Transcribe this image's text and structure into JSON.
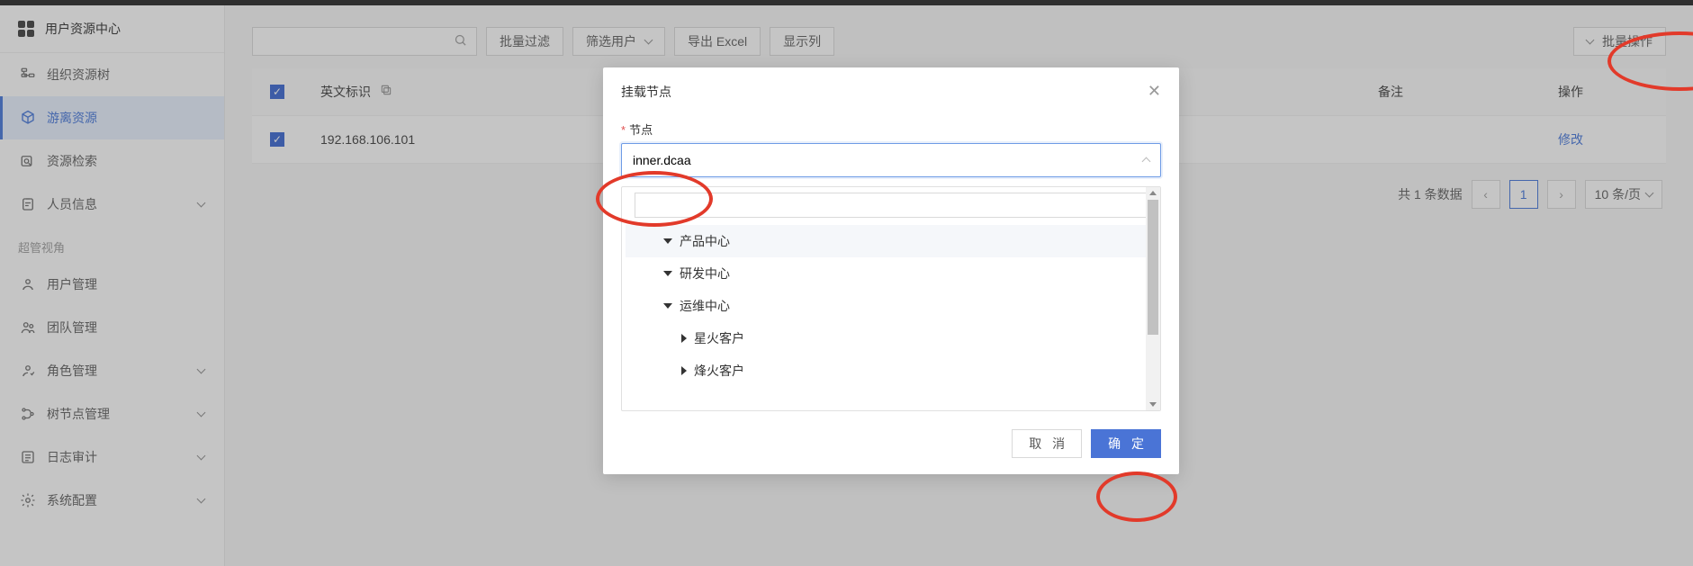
{
  "sidebar": {
    "title": "用户资源中心",
    "items": [
      {
        "label": "组织资源树",
        "icon": "tree-icon",
        "expandable": false
      },
      {
        "label": "游离资源",
        "icon": "cube-icon",
        "expandable": false,
        "active": true
      },
      {
        "label": "资源检索",
        "icon": "search-icon",
        "expandable": false
      },
      {
        "label": "人员信息",
        "icon": "clipboard-icon",
        "expandable": true
      }
    ],
    "section_label": "超管视角",
    "admin_items": [
      {
        "label": "用户管理",
        "icon": "user-icon",
        "expandable": false
      },
      {
        "label": "团队管理",
        "icon": "team-icon",
        "expandable": false
      },
      {
        "label": "角色管理",
        "icon": "role-icon",
        "expandable": true
      },
      {
        "label": "树节点管理",
        "icon": "branch-icon",
        "expandable": true
      },
      {
        "label": "日志审计",
        "icon": "log-icon",
        "expandable": true
      },
      {
        "label": "系统配置",
        "icon": "gear-icon",
        "expandable": true
      }
    ]
  },
  "toolbar": {
    "search_placeholder": "",
    "filter_label": "批量过滤",
    "select_label": "筛选用户",
    "export_label": "导出 Excel",
    "columns_label": "显示列",
    "batch_label": "批量操作"
  },
  "table": {
    "headers": {
      "name": "英文标识",
      "remark": "备注",
      "action": "操作"
    },
    "rows": [
      {
        "name": "192.168.106.101",
        "remark": "",
        "action": "修改"
      }
    ]
  },
  "pagination": {
    "total_text": "共 1 条数据",
    "current": "1",
    "page_size_label": "10 条/页"
  },
  "modal": {
    "title": "挂载节点",
    "field_label": "节点",
    "input_value": "inner.dcaa",
    "tree": [
      {
        "label": "产品中心",
        "level": 1,
        "expanded": true,
        "hover": true
      },
      {
        "label": "研发中心",
        "level": 1,
        "expanded": true
      },
      {
        "label": "运维中心",
        "level": 1,
        "expanded": true
      },
      {
        "label": "星火客户",
        "level": 2,
        "expanded": false
      },
      {
        "label": "烽火客户",
        "level": 2,
        "expanded": false
      }
    ],
    "cancel_label": "取 消",
    "confirm_label": "确 定"
  }
}
